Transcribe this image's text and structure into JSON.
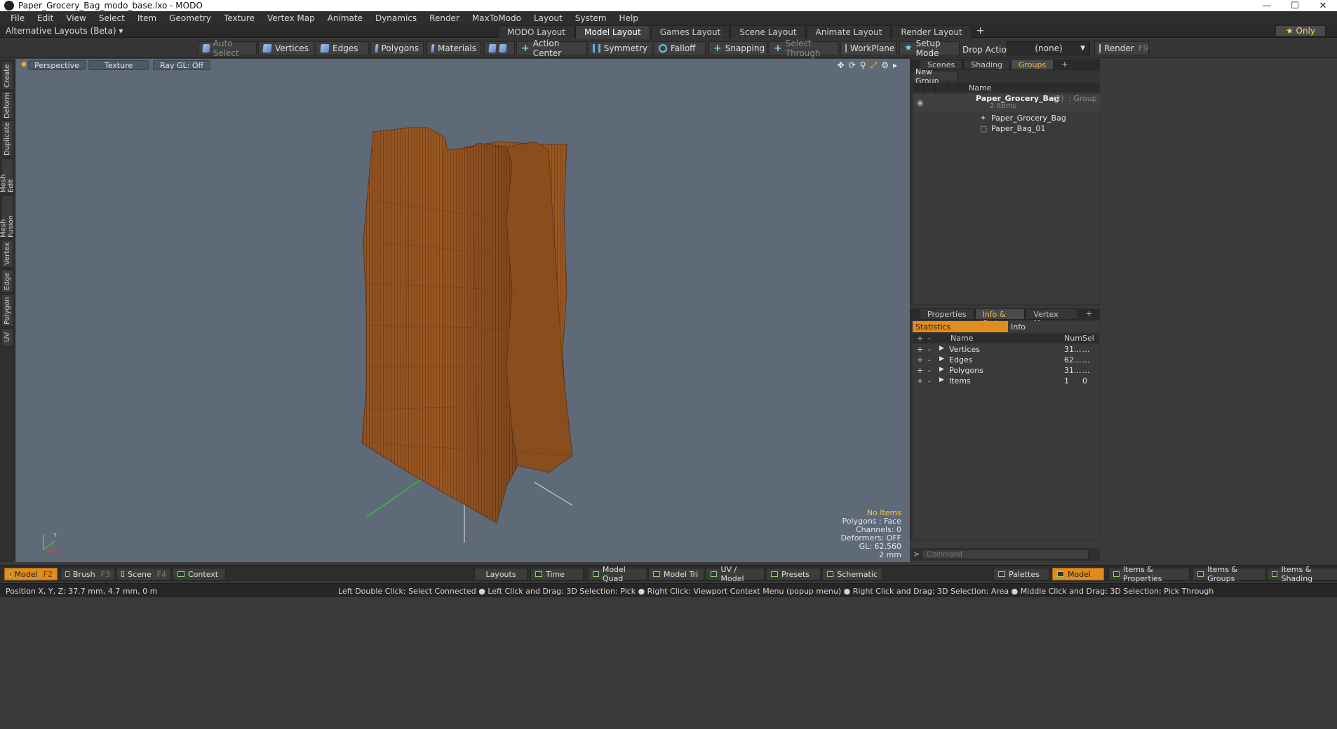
{
  "window": {
    "title": "Paper_Grocery_Bag_modo_base.lxo - MODO",
    "minimize": "—",
    "maximize": "☐",
    "close": "✕"
  },
  "menu": [
    "File",
    "Edit",
    "View",
    "Select",
    "Item",
    "Geometry",
    "Texture",
    "Vertex Map",
    "Animate",
    "Dynamics",
    "Render",
    "MaxToModo",
    "Layout",
    "System",
    "Help"
  ],
  "layouts": {
    "alt_label": "Alternative Layouts (Beta) ▾",
    "tabs": [
      "MODO Layout",
      "Model Layout",
      "Games Layout",
      "Scene Layout",
      "Animate Layout",
      "Render Layout"
    ],
    "active": "Model Layout",
    "add": "+",
    "only": "★ Only"
  },
  "toolbar": {
    "auto_select": "Auto Select",
    "vertices": "Vertices",
    "edges": "Edges",
    "polygons": "Polygons",
    "materials": "Materials",
    "action_center": "Action Center",
    "symmetry": "Symmetry",
    "falloff": "Falloff",
    "snapping": "Snapping",
    "select_through": "Select Through",
    "workplane": "WorkPlane",
    "setup_mode": "Setup Mode",
    "drop_action_label": "Drop Action",
    "drop_action_value": "(none)",
    "render": "Render",
    "render_key": "F9"
  },
  "left_tabs": [
    "Create",
    "Deform",
    "Duplicate",
    "Mesh Edit",
    "Mesh Fusion",
    "Vertex",
    "Edge",
    "Polygon",
    "UV"
  ],
  "viewport": {
    "view": "Perspective",
    "shading": "Texture",
    "raygl": "Ray GL: Off",
    "info": {
      "no_items": "No Items",
      "polygons": "Polygons : Face",
      "channels": "Channels: 0",
      "deformers": "Deformers: OFF",
      "gl": "GL: 62,560",
      "scale": "2 mm"
    },
    "axis_y": "Y"
  },
  "groups_panel": {
    "tabs": [
      "Scenes",
      "Shading",
      "Groups"
    ],
    "active": "Groups",
    "add": "+",
    "new_group": "New Group",
    "name_header": "Name",
    "root": {
      "name": "Paper_Grocery_Bag",
      "count": "(2)",
      "type": ": Group",
      "sub": "2 Items"
    },
    "children": [
      "Paper_Grocery_Bag",
      "Paper_Bag_01"
    ]
  },
  "info_panel": {
    "tabs": [
      "Properties",
      "Info & Stats",
      "Vertex Maps"
    ],
    "active": "Info & Stats",
    "add": "+",
    "sub_tabs": [
      "Statistics",
      "Info"
    ],
    "headers": {
      "add": "+",
      "remove": "-",
      "name": "Name",
      "num": "Num",
      "sel": "Sel"
    },
    "rows": [
      {
        "name": "Vertices",
        "num": "31...",
        "sel": "..."
      },
      {
        "name": "Edges",
        "num": "62...",
        "sel": "..."
      },
      {
        "name": "Polygons",
        "num": "31...",
        "sel": "..."
      },
      {
        "name": "Items",
        "num": "1",
        "sel": "0"
      }
    ]
  },
  "command": {
    "prompt": ">",
    "placeholder": "Command"
  },
  "bottom": {
    "model": "Model",
    "model_key": "F2",
    "brush": "Brush",
    "brush_key": "F3",
    "scene": "Scene",
    "scene_key": "F4",
    "context": "Context",
    "layouts": "Layouts",
    "time": "Time",
    "model_quad": "Model Quad",
    "model_tri": "Model Tri",
    "uv_model": "UV / Model",
    "presets": "Presets",
    "schematic": "Schematic",
    "palettes": "Palettes",
    "model_right": "Model",
    "items_props": "Items & Properties",
    "items_groups": "Items & Groups",
    "items_shading": "Items & Shading"
  },
  "status": {
    "position": "Position X, Y, Z:   37.7 mm, 4.7 mm, 0 m",
    "hint": "Left Double Click: Select Connected ● Left Click and Drag: 3D Selection: Pick ● Right Click: Viewport Context Menu (popup menu) ● Right Click and Drag: 3D Selection: Area ● Middle Click and Drag: 3D Selection: Pick Through"
  },
  "colors": {
    "accent": "#e7a23a",
    "viewport_bg": "#5e6a78",
    "bag": "#9c5a22"
  }
}
